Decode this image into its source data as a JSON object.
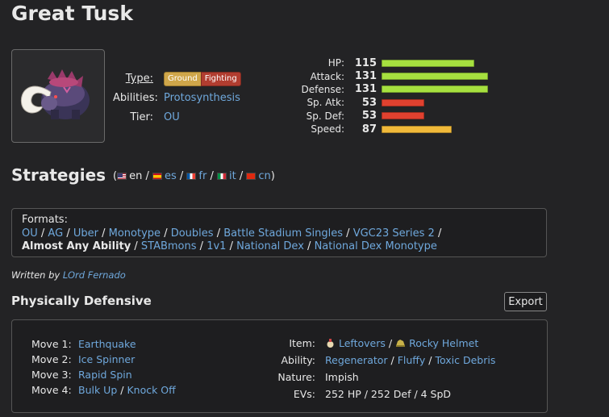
{
  "pokemon": {
    "name": "Great Tusk",
    "type_label": "Type:",
    "types": [
      "Ground",
      "Fighting"
    ],
    "abilities_label": "Abilities:",
    "ability": "Protosynthesis",
    "tier_label": "Tier:",
    "tier": "OU"
  },
  "stats": [
    {
      "label": "HP:",
      "value": 115,
      "fill": 0.82,
      "color": "#a6e03f"
    },
    {
      "label": "Attack:",
      "value": 131,
      "fill": 0.94,
      "color": "#a6e03f"
    },
    {
      "label": "Defense:",
      "value": 131,
      "fill": 0.94,
      "color": "#a6e03f"
    },
    {
      "label": "Sp. Atk:",
      "value": 53,
      "fill": 0.38,
      "color": "#e0412f"
    },
    {
      "label": "Sp. Def:",
      "value": 53,
      "fill": 0.38,
      "color": "#e0412f"
    },
    {
      "label": "Speed:",
      "value": 87,
      "fill": 0.62,
      "color": "#f0b93a"
    }
  ],
  "strategies": {
    "heading": "Strategies",
    "languages": [
      {
        "code": "en",
        "flag": "us-flag",
        "link": false
      },
      {
        "code": "es",
        "flag": "spain-flag",
        "link": true
      },
      {
        "code": "fr",
        "flag": "france-flag",
        "link": true
      },
      {
        "code": "it",
        "flag": "italy-flag",
        "link": true
      },
      {
        "code": "cn",
        "flag": "china-flag",
        "link": true
      }
    ]
  },
  "formats": {
    "label": "Formats:",
    "line1": [
      "OU",
      "AG",
      "Uber",
      "Monotype",
      "Doubles",
      "Battle Stadium Singles",
      "VGC23 Series 2"
    ],
    "line2_current": "Almost Any Ability",
    "line2": [
      "STABmons",
      "1v1",
      "National Dex",
      "National Dex Monotype"
    ]
  },
  "author": {
    "prefix": "Written by",
    "name": "LOrd Fernado"
  },
  "set": {
    "name": "Physically Defensive",
    "export_label": "Export",
    "moves": [
      {
        "label": "Move 1:",
        "options": [
          "Earthquake"
        ]
      },
      {
        "label": "Move 2:",
        "options": [
          "Ice Spinner"
        ]
      },
      {
        "label": "Move 3:",
        "options": [
          "Rapid Spin"
        ]
      },
      {
        "label": "Move 4:",
        "options": [
          "Bulk Up",
          "Knock Off"
        ]
      }
    ],
    "item_label": "Item:",
    "items": [
      "Leftovers",
      "Rocky Helmet"
    ],
    "ability_label": "Ability:",
    "abilities": [
      "Regenerator",
      "Fluffy",
      "Toxic Debris"
    ],
    "nature_label": "Nature:",
    "nature": "Impish",
    "evs_label": "EVs:",
    "evs": "252 HP / 252 Def / 4 SpD"
  }
}
